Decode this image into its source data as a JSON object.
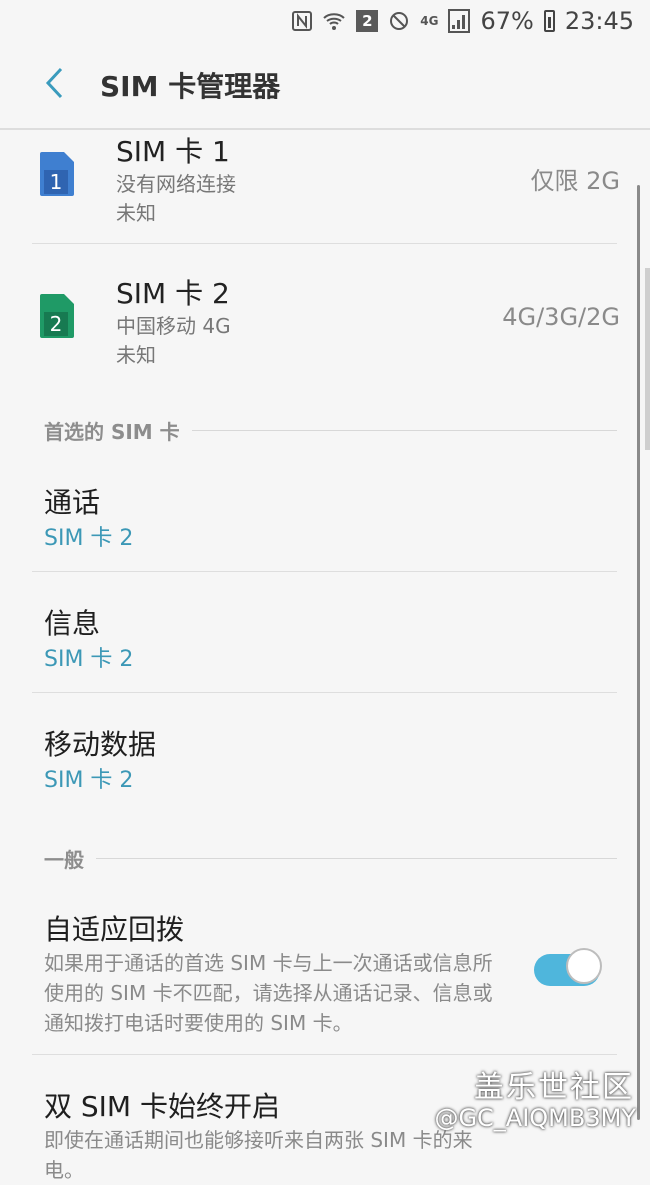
{
  "status_bar": {
    "nfc_icon": "nfc-icon",
    "wifi_icon": "wifi-icon",
    "sim2_badge": "2",
    "dnd_icon": "do-not-disturb-icon",
    "network_badge": "4G",
    "signal_icon": "signal-icon",
    "battery_percent": "67%",
    "battery_icon": "battery-icon",
    "time": "23:45"
  },
  "header": {
    "back_icon": "back-arrow-icon",
    "title": "SIM 卡管理器"
  },
  "sims": [
    {
      "name": "SIM 卡 1",
      "status": "没有网络连接",
      "detail": "未知",
      "network": "仅限 2G",
      "color": "#3f7fd0",
      "number": "1"
    },
    {
      "name": "SIM 卡 2",
      "status": "中国移动 4G",
      "detail": "未知",
      "network": "4G/3G/2G",
      "color": "#1f9a66",
      "number": "2"
    }
  ],
  "preferred": {
    "section_title": "首选的 SIM 卡",
    "items": [
      {
        "title": "通话",
        "value": "SIM 卡 2"
      },
      {
        "title": "信息",
        "value": "SIM 卡 2"
      },
      {
        "title": "移动数据",
        "value": "SIM 卡 2"
      }
    ]
  },
  "general": {
    "section_title": "一般",
    "adaptive_title": "自适应回拨",
    "adaptive_desc": "如果用于通话的首选 SIM 卡与上一次通话或信息所使用的 SIM 卡不匹配，请选择从通话记录、信息或通知拨打电话时要使用的 SIM 卡。",
    "adaptive_toggle": "on",
    "dual_title": "双 SIM 卡始终开启",
    "dual_desc": "即使在通话期间也能够接听来自两张 SIM 卡的来电。"
  },
  "watermark": {
    "line1": "盖乐世社区",
    "line2": "@GC_AIQMB3MY"
  },
  "colors": {
    "accent": "#3c98b6",
    "toggle_on": "#4fb6dc"
  }
}
